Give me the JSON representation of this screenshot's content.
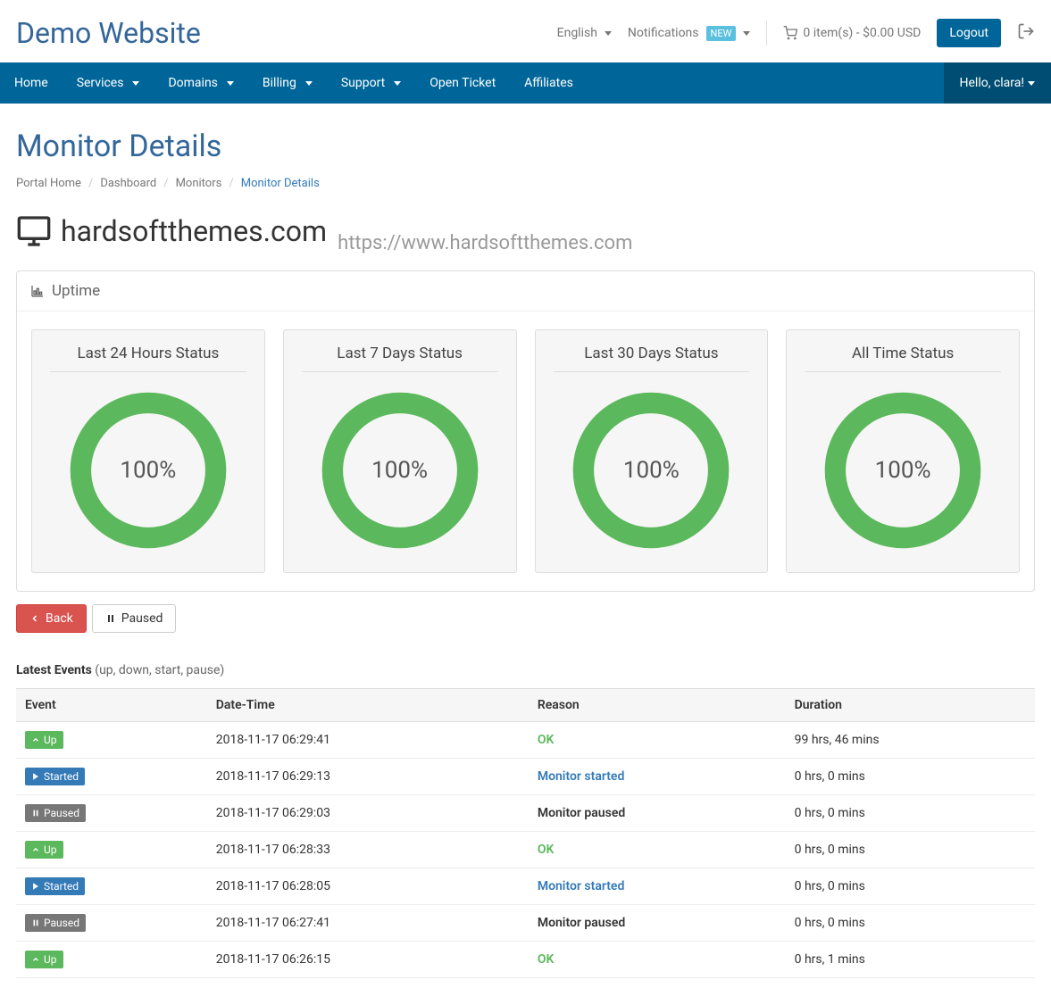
{
  "brand": "Demo Website",
  "topbar": {
    "language": "English",
    "notifications_label": "Notifications",
    "notifications_badge": "NEW",
    "cart_text": "0 item(s) - $0.00 USD",
    "logout": "Logout"
  },
  "nav": {
    "items": [
      {
        "label": "Home",
        "dropdown": false
      },
      {
        "label": "Services",
        "dropdown": true
      },
      {
        "label": "Domains",
        "dropdown": true
      },
      {
        "label": "Billing",
        "dropdown": true
      },
      {
        "label": "Support",
        "dropdown": true
      },
      {
        "label": "Open Ticket",
        "dropdown": false
      },
      {
        "label": "Affiliates",
        "dropdown": false
      }
    ],
    "greeting": "Hello, clara!"
  },
  "page_title": "Monitor Details",
  "breadcrumb": {
    "items": [
      "Portal Home",
      "Dashboard",
      "Monitors"
    ],
    "active": "Monitor Details"
  },
  "monitor": {
    "name": "hardsoftthemes.com",
    "url": "https://www.hardsoftthemes.com"
  },
  "uptime": {
    "panel_title": "Uptime",
    "cards": [
      {
        "title": "Last 24 Hours Status",
        "value": "100%"
      },
      {
        "title": "Last 7 Days Status",
        "value": "100%"
      },
      {
        "title": "Last 30 Days Status",
        "value": "100%"
      },
      {
        "title": "All Time Status",
        "value": "100%"
      }
    ]
  },
  "buttons": {
    "back": "Back",
    "paused": "Paused"
  },
  "events": {
    "heading_strong": "Latest Events",
    "heading_rest": " (up, down, start, pause)",
    "columns": [
      "Event",
      "Date-Time",
      "Reason",
      "Duration"
    ],
    "rows": [
      {
        "type": "up",
        "type_label": "Up",
        "datetime": "2018-11-17 06:29:41",
        "reason": "OK",
        "reason_class": "ok",
        "duration": "99 hrs, 46 mins"
      },
      {
        "type": "started",
        "type_label": "Started",
        "datetime": "2018-11-17 06:29:13",
        "reason": "Monitor started",
        "reason_class": "started",
        "duration": "0 hrs, 0 mins"
      },
      {
        "type": "paused",
        "type_label": "Paused",
        "datetime": "2018-11-17 06:29:03",
        "reason": "Monitor paused",
        "reason_class": "paused",
        "duration": "0 hrs, 0 mins"
      },
      {
        "type": "up",
        "type_label": "Up",
        "datetime": "2018-11-17 06:28:33",
        "reason": "OK",
        "reason_class": "ok",
        "duration": "0 hrs, 0 mins"
      },
      {
        "type": "started",
        "type_label": "Started",
        "datetime": "2018-11-17 06:28:05",
        "reason": "Monitor started",
        "reason_class": "started",
        "duration": "0 hrs, 0 mins"
      },
      {
        "type": "paused",
        "type_label": "Paused",
        "datetime": "2018-11-17 06:27:41",
        "reason": "Monitor paused",
        "reason_class": "paused",
        "duration": "0 hrs, 0 mins"
      },
      {
        "type": "up",
        "type_label": "Up",
        "datetime": "2018-11-17 06:26:15",
        "reason": "OK",
        "reason_class": "ok",
        "duration": "0 hrs, 1 mins"
      }
    ]
  },
  "chart_data": {
    "type": "pie",
    "series": [
      {
        "name": "Last 24 Hours Status",
        "values": [
          {
            "label": "Up",
            "value": 100
          }
        ]
      },
      {
        "name": "Last 7 Days Status",
        "values": [
          {
            "label": "Up",
            "value": 100
          }
        ]
      },
      {
        "name": "Last 30 Days Status",
        "values": [
          {
            "label": "Up",
            "value": 100
          }
        ]
      },
      {
        "name": "All Time Status",
        "values": [
          {
            "label": "Up",
            "value": 100
          }
        ]
      }
    ],
    "colors": {
      "Up": "#5cb85c"
    }
  }
}
